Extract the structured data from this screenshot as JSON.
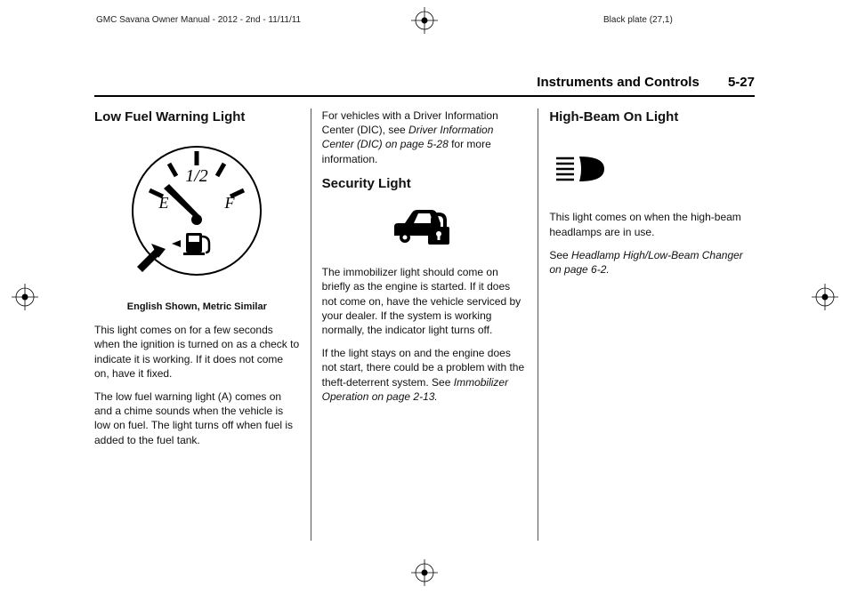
{
  "print": {
    "title": "GMC Savana Owner Manual - 2012 - 2nd - 11/11/11",
    "plate": "Black plate (27,1)"
  },
  "header": {
    "chapter": "Instruments and Controls",
    "page": "5-27"
  },
  "col1": {
    "h_lowfuel": "Low Fuel Warning Light",
    "gauge_half": "1/2",
    "gauge_e": "E",
    "gauge_f": "F",
    "caption": "English Shown, Metric Similar",
    "p1": "This light comes on for a few seconds when the ignition is turned on as a check to indicate it is working. If it does not come on, have it fixed.",
    "p2": "The low fuel warning light (A) comes on and a chime sounds when the vehicle is low on fuel. The light turns off when fuel is added to the fuel tank."
  },
  "col2": {
    "p_dic_a": "For vehicles with a Driver Information Center (DIC), see ",
    "p_dic_b": "Driver Information Center (DIC) on page 5-28",
    "p_dic_c": " for more information.",
    "h_security": "Security Light",
    "p_sec1": "The immobilizer light should come on briefly as the engine is started. If it does not come on, have the vehicle serviced by your dealer. If the system is working normally, the indicator light turns off.",
    "p_sec2_a": "If the light stays on and the engine does not start, there could be a problem with the theft-deterrent system. See ",
    "p_sec2_b": "Immobilizer Operation on page 2-13.",
    "p_sec2_c": ""
  },
  "col3": {
    "h_highbeam": "High-Beam On Light",
    "p_hb1": "This light comes on when the high-beam headlamps are in use.",
    "p_hb2_a": "See ",
    "p_hb2_b": "Headlamp High/Low-Beam Changer on page 6-2.",
    "p_hb2_c": ""
  }
}
